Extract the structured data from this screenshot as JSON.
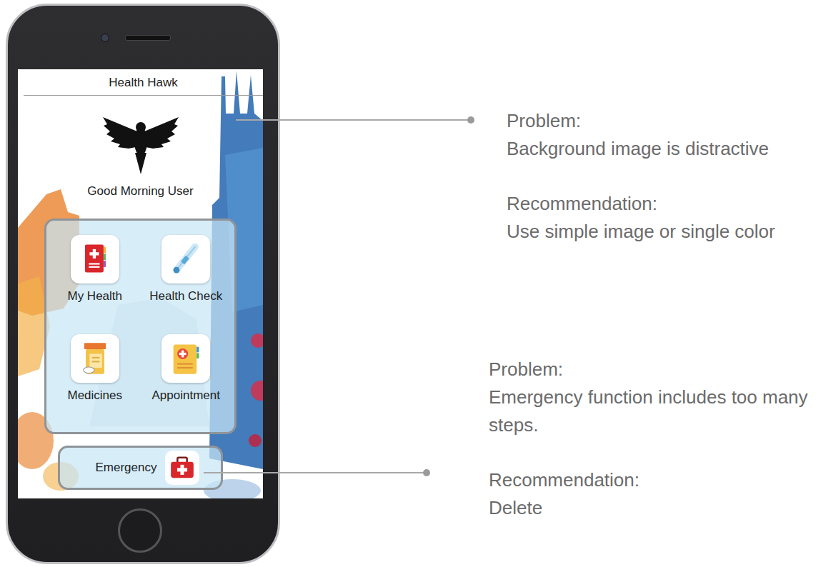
{
  "app": {
    "title": "Health Hawk",
    "greeting": "Good Morning User"
  },
  "tiles": [
    {
      "label": "My Health",
      "kind": "record"
    },
    {
      "label": "Health Check",
      "kind": "thermometer"
    },
    {
      "label": "Medicines",
      "kind": "pill-bottle"
    },
    {
      "label": "Appointment",
      "kind": "clipboard"
    }
  ],
  "emergency": {
    "label": "Emergency"
  },
  "annotations": [
    {
      "problem_heading": "Problem:",
      "problem": "Background image is distractive",
      "recommendation_heading": "Recommendation:",
      "recommendation": "Use simple image or single color"
    },
    {
      "problem_heading": "Problem:",
      "problem": "Emergency function includes too many steps.",
      "recommendation_heading": "Recommendation:",
      "recommendation": "Delete"
    }
  ]
}
